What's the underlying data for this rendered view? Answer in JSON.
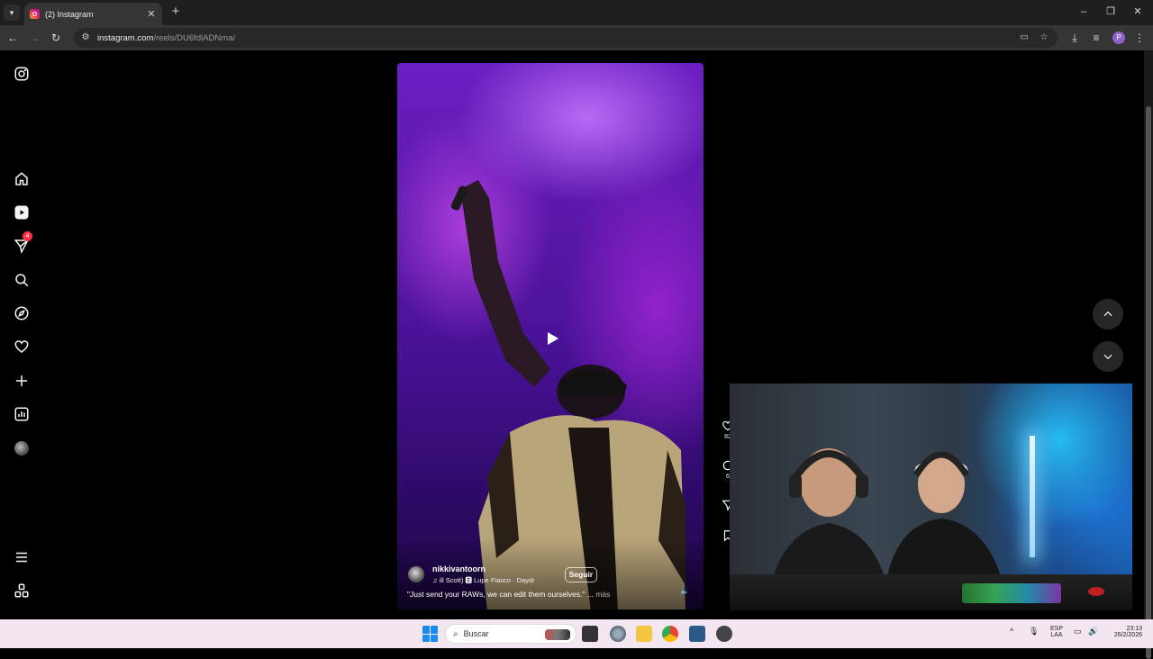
{
  "browser": {
    "tab": {
      "title": "(2) Instagram"
    },
    "url": {
      "host": "instagram.com",
      "path": "/reels/DU6fdlADNma/"
    },
    "profile_initial": "P"
  },
  "sidebar": {
    "notifications_badge": "4",
    "items": [
      {
        "name": "instagram-logo-icon"
      },
      {
        "name": "home-icon"
      },
      {
        "name": "reels-icon"
      },
      {
        "name": "direct-messages-icon"
      },
      {
        "name": "search-icon"
      },
      {
        "name": "explore-icon"
      },
      {
        "name": "heart-icon"
      },
      {
        "name": "create-icon"
      },
      {
        "name": "dashboard-icon"
      },
      {
        "name": "profile-avatar"
      },
      {
        "name": "menu-icon"
      },
      {
        "name": "also-from-meta-icon"
      }
    ]
  },
  "reel": {
    "username": "nikkivantoorn",
    "audio": "♫ ill Scott) 🅴 Lupe Fiasco · Daydr",
    "follow_label": "Seguir",
    "caption": "\"Just send your RAWs, we can edit them ourselves.\" ...",
    "more_label": "más",
    "like_count": "82",
    "comment_count": "6"
  },
  "taskbar": {
    "search_label": "Buscar",
    "lang_top": "ESP",
    "lang_bottom": "LAA",
    "time": "23:13",
    "date": "26/2/2026"
  },
  "colors": {
    "browser_bg": "#1f1f1f",
    "page_bg": "#000000",
    "badge": "#ff3040",
    "taskbar_bg": "#f3e6f0"
  }
}
